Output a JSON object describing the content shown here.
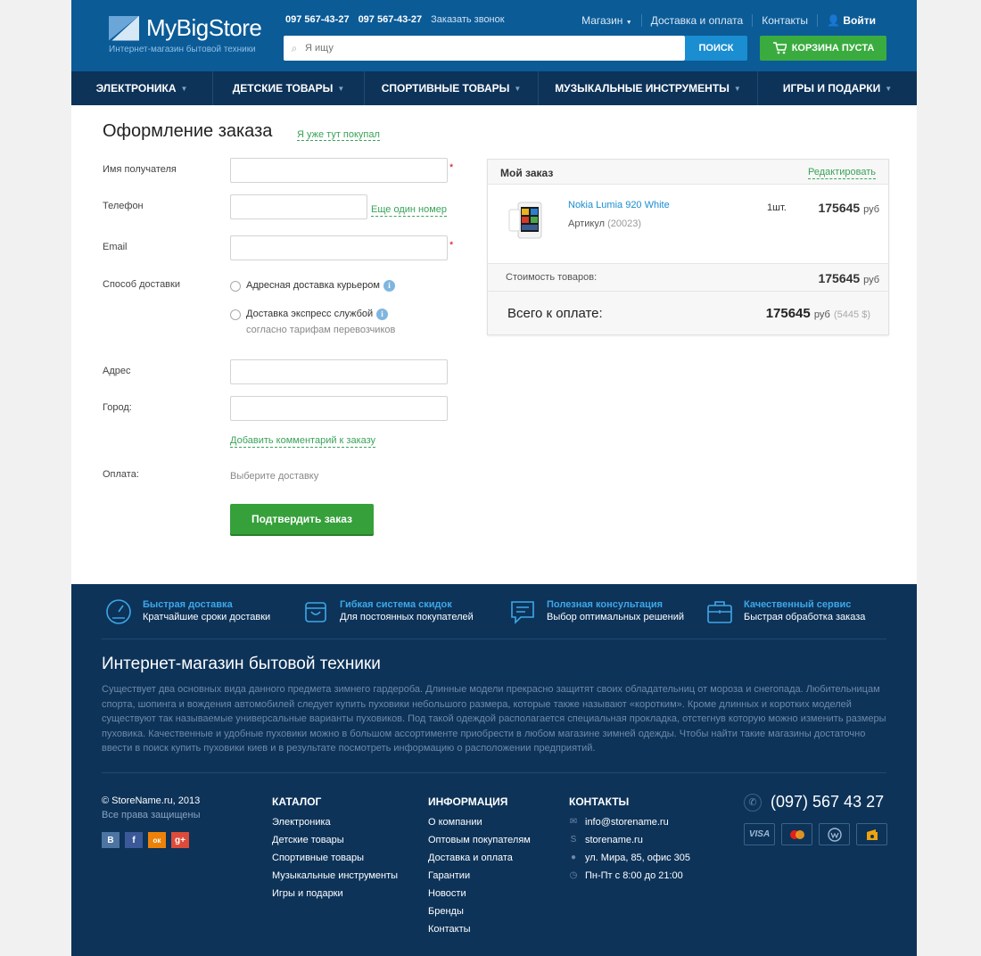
{
  "header": {
    "logo_text": "MyBigStore",
    "tagline": "Интернет-магазин бытовой техники",
    "phone1": "097 567-43-27",
    "phone2": "097 567-43-27",
    "callback": "Заказать звонок",
    "nav": [
      "Магазин",
      "Доставка  и  оплата",
      "Контакты"
    ],
    "login": "Войти",
    "search_placeholder": "Я ищу",
    "search_button": "ПОИСК",
    "cart_button": "КОРЗИНА ПУСТА"
  },
  "categories": [
    "ЭЛЕКТРОНИКА",
    "ДЕТСКИЕ ТОВАРЫ",
    "СПОРТИВНЫЕ ТОВАРЫ",
    "МУЗЫКАЛЬНЫЕ ИНСТРУМЕНТЫ",
    "ИГРЫ И ПОДАРКИ"
  ],
  "form": {
    "title": "Оформление заказа",
    "already_bought": "Я уже тут покупал",
    "name_label": "Имя получателя",
    "phone_label": "Телефон",
    "another_number": "Еще один номер",
    "email_label": "Email",
    "delivery_label": "Способ доставки",
    "delivery_opt1": "Адресная доставка курьером",
    "delivery_opt2": "Доставка экспресс службой",
    "delivery_opt2_sub": "согласно тарифам перевозчиков",
    "address_label": "Адрес",
    "city_label": "Город:",
    "add_comment": "Добавить комментарий к заказу",
    "payment_label": "Оплата:",
    "payment_hint": "Выберите доставку",
    "confirm_button": "Подтвердить заказ",
    "required_mark": "*",
    "info_mark": "i"
  },
  "order": {
    "title": "Мой заказ",
    "edit": "Редактировать",
    "product_name": "Nokia Lumia 920 White",
    "article_label": "Артикул",
    "article_code": "(20023)",
    "qty": "1шт.",
    "price": "175645",
    "currency": "руб",
    "subtotal_label": "Стоимость товаров:",
    "subtotal": "175645",
    "total_label": "Всего к оплате:",
    "total": "175645",
    "total_usd": "(5445 $)"
  },
  "features": [
    {
      "title": "Быстрая доставка",
      "text": "Кратчайшие сроки доставки",
      "icon": "speedometer-icon"
    },
    {
      "title": "Гибкая система скидок",
      "text": "Для постоянных покупателей",
      "icon": "bag-icon"
    },
    {
      "title": "Полезная консультация",
      "text": "Выбор оптимальных решений",
      "icon": "chat-icon"
    },
    {
      "title": "Качественный сервис",
      "text": "Быстрая обработка заказа",
      "icon": "briefcase-icon"
    }
  ],
  "footer": {
    "title": "Интернет-магазин бытовой техники",
    "text": "Существует два основных вида данного предмета зимнего гардероба. Длинные модели прекрасно защитят своих обладательниц от мороза и снегопада. Любительницам спорта, шопинга и вождения автомобилей следует купить пуховики небольшого размера, которые также называют «коротким». Кроме длинных и коротких моделей существуют так называемые универсальные варианты пуховиков. Под такой одеждой располагается специальная прокладка, отстегнув которую можно изменить размеры пуховика. Качественные и удобные пуховики можно в большом ассортименте приобрести в любом магазине зимней одежды. Чтобы найти такие магазины достаточно ввести в поиск купить пуховики киев и в результате посмотреть информацию о расположении предприятий.",
    "copyright": "© StoreName.ru, 2013",
    "rights": "Все права защищены",
    "social": [
      "В",
      "f",
      "ок",
      "g+"
    ],
    "catalog_title": "КАТАЛОГ",
    "catalog": [
      "Электроника",
      "Детские товары",
      "Спортивные товары",
      "Музыкальные инструменты",
      "Игры и подарки"
    ],
    "info_title": "ИНФОРМАЦИЯ",
    "info": [
      "О компании",
      "Оптовым покупателям",
      "Доставка и оплата",
      "Гарантии",
      "Новости",
      "Бренды",
      "Контакты"
    ],
    "contacts_title": "КОНТАКТЫ",
    "email": "info@storename.ru",
    "skype": "storename.ru",
    "address": "ул. Мира, 85, офис 305",
    "hours": "Пн-Пт с 8:00 до 21:00",
    "phone": "(097) 567 43 27",
    "payments": [
      "VISA",
      "MC",
      "WM",
      "YM"
    ]
  },
  "colors": {
    "header_blue": "#0b5b97",
    "nav_dark": "#0d3359",
    "green": "#3aac3f",
    "link_blue": "#1a8ed1"
  }
}
